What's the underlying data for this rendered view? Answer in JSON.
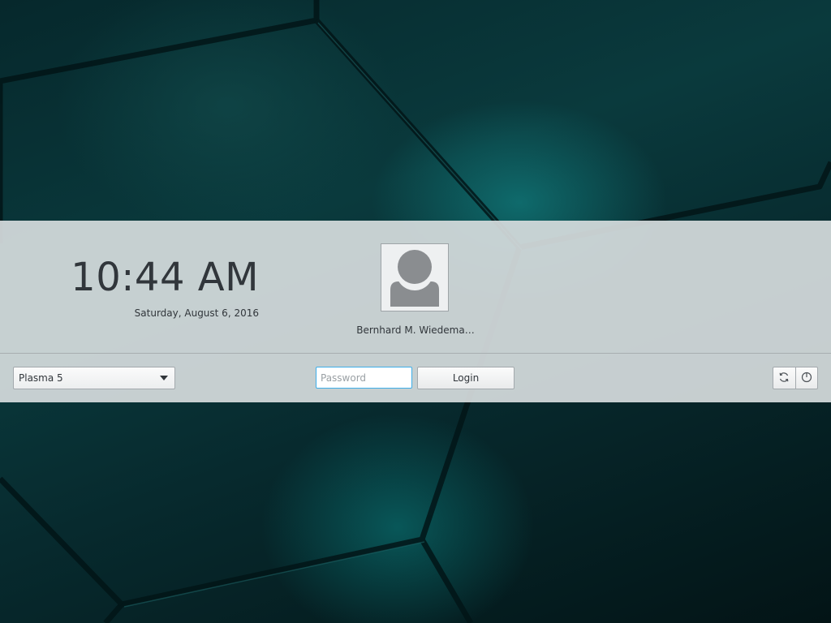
{
  "login": {
    "time": "10:44 AM",
    "date": "Saturday, August 6, 2016",
    "user_name": "Bernhard M. Wiedema…",
    "session_selected": "Plasma 5",
    "password_placeholder": "Password",
    "login_label": "Login"
  },
  "icons": {
    "avatar": "user-avatar-icon",
    "session_dropdown": "chevron-down-icon",
    "switch_user": "refresh-icon",
    "shutdown": "power-icon"
  },
  "colors": {
    "panel_bg": "#d5dcdd",
    "text": "#31363b",
    "focus_accent": "#3daee9"
  }
}
